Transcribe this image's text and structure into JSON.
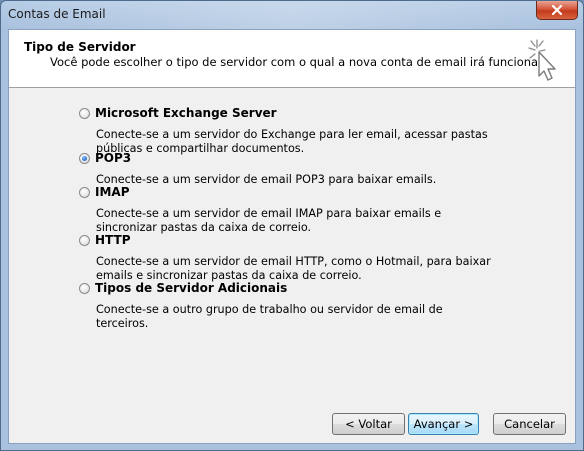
{
  "window": {
    "title": "Contas de Email",
    "close_icon": "close-icon"
  },
  "header": {
    "title": "Tipo de Servidor",
    "subtitle": "Você pode escolher o tipo de servidor com o qual a nova conta de email irá funcionar.",
    "icon": "wizard-cursor-icon"
  },
  "options": [
    {
      "label": "Microsoft Exchange Server",
      "description": "Conecte-se a um servidor do Exchange para ler email, acessar pastas públicas e compartilhar documentos.",
      "checked": false
    },
    {
      "label": "POP3",
      "description": "Conecte-se a um servidor de email POP3 para baixar emails.",
      "checked": true
    },
    {
      "label": "IMAP",
      "description": "Conecte-se a um servidor de email IMAP para baixar emails e sincronizar pastas da caixa de correio.",
      "checked": false
    },
    {
      "label": "HTTP",
      "description": "Conecte-se a um servidor de email HTTP, como o Hotmail, para baixar emails e sincronizar pastas da caixa de correio.",
      "checked": false
    },
    {
      "label": "Tipos de Servidor Adicionais",
      "description": "Conecte-se a outro grupo de trabalho ou servidor de email de terceiros.",
      "checked": false
    }
  ],
  "buttons": {
    "back": "< Voltar",
    "next": "Avançar >",
    "cancel": "Cancelar"
  }
}
